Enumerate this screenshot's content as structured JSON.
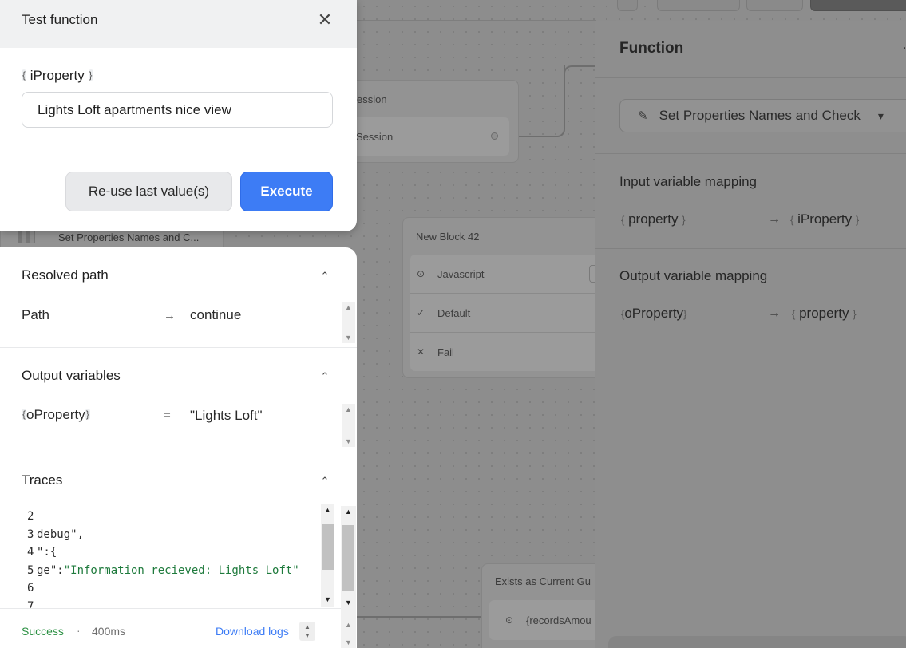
{
  "modal": {
    "title": "Test function",
    "variable": "iProperty",
    "input_value": "Lights Loft apartments nice view",
    "reuse_label": "Re-use last value(s)",
    "execute_label": "Execute"
  },
  "results": {
    "resolved_path": {
      "title": "Resolved path",
      "key": "Path",
      "value": "continue"
    },
    "output_variables": {
      "title": "Output variables",
      "key": "oProperty",
      "value": "\"Lights Loft\""
    },
    "traces": {
      "title": "Traces",
      "lines": [
        {
          "n": "2",
          "text": ""
        },
        {
          "n": "3",
          "text": "debug\","
        },
        {
          "n": "4",
          "text": "\":{"
        },
        {
          "n": "5",
          "pre": "ge\":",
          "str": "\"Information recieved: Lights Loft\""
        },
        {
          "n": "6",
          "text": ""
        },
        {
          "n": "7",
          "text": ""
        }
      ]
    },
    "footer": {
      "status": "Success",
      "separator": "·",
      "duration": "400ms",
      "download_label": "Download logs"
    }
  },
  "canvas": {
    "session_block": {
      "title": "ession",
      "row": "Session"
    },
    "sliver_label": "Set Properties Names and C...",
    "block42": {
      "title": "New Block 42",
      "rows": [
        {
          "icon": "code-icon",
          "label": "Javascript"
        },
        {
          "icon": "check-icon",
          "label": "Default"
        },
        {
          "icon": "x-icon",
          "label": "Fail"
        }
      ]
    },
    "exists_block": {
      "title": "Exists as Current Gu",
      "row": "{recordsAmou"
    }
  },
  "function_panel": {
    "title": "Function",
    "selected_function": "Set Properties Names and Check",
    "input_mapping_title": "Input variable mapping",
    "input_from": "property",
    "input_to": "iProperty",
    "output_mapping_title": "Output variable mapping",
    "output_from": "oProperty",
    "output_to": "property"
  }
}
